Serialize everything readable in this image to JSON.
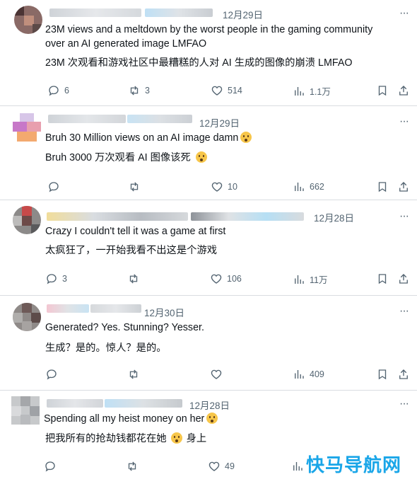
{
  "tweets": [
    {
      "date": "12月29日",
      "more": "···",
      "text_en": "23M views and a meltdown by the worst people in the gaming community\nover an AI generated image LMFAO",
      "text_zh": "23M 次观看和游戏社区中最糟糕的人对 AI 生成的图像的崩溃 LMFAO",
      "replies": "6",
      "retweets": "3",
      "likes": "514",
      "views": "1.1万"
    },
    {
      "date": "12月29日",
      "more": "···",
      "text_en": "Bruh 30 Million views on an AI image damn",
      "text_zh": "Bruh 3000 万次观看 AI 图像该死",
      "replies": "",
      "retweets": "",
      "likes": "10",
      "views": "662"
    },
    {
      "date": "12月28日",
      "more": "···",
      "text_en": "Crazy I couldn't tell it was a game at first",
      "text_zh": "太疯狂了，一开始我看不出这是个游戏",
      "replies": "3",
      "retweets": "",
      "likes": "106",
      "views": "11万"
    },
    {
      "date": "12月30日",
      "more": "···",
      "text_en": "Generated? Yes. Stunning? Yesser.",
      "text_zh": "生成？是的。惊人？是的。",
      "replies": "",
      "retweets": "",
      "likes": "",
      "views": "409"
    },
    {
      "date": "12月28日",
      "more": "···",
      "text_en": "Spending all my heist money on her",
      "text_zh": "把我所有的抢劫钱都花在她",
      "text_zh_tail": "身上",
      "replies": "",
      "retweets": "",
      "likes": "49",
      "views": ""
    }
  ],
  "watermark": "快马导航网",
  "colors": {
    "text": "#0f1419",
    "muted": "#536471",
    "divider": "#d9dde1",
    "watermark": "#1aa6e8"
  }
}
